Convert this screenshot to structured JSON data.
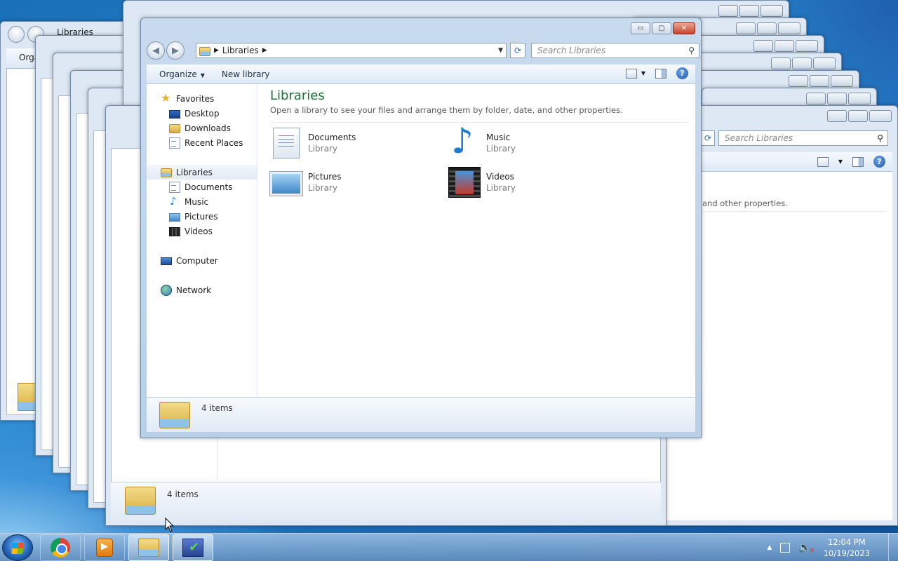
{
  "window": {
    "address": {
      "root_label": "Libraries"
    },
    "search_placeholder": "Search Libraries",
    "controls": {
      "minimize": "▭",
      "maximize": "▢",
      "close": "✕"
    },
    "toolbar": {
      "organize_label": "Organize",
      "new_library_label": "New library",
      "help_label": "?"
    },
    "nav": {
      "favorites": "Favorites",
      "desktop": "Desktop",
      "downloads": "Downloads",
      "recent_places": "Recent Places",
      "libraries": "Libraries",
      "documents": "Documents",
      "music": "Music",
      "pictures": "Pictures",
      "videos": "Videos",
      "computer": "Computer",
      "network": "Network"
    },
    "content": {
      "title": "Libraries",
      "subtitle": "Open a library to see your files and arrange them by folder, date, and other properties.",
      "libraries": [
        {
          "name": "Documents",
          "type": "Library",
          "icon": "documents-library-icon"
        },
        {
          "name": "Music",
          "type": "Library",
          "icon": "music-library-icon"
        },
        {
          "name": "Pictures",
          "type": "Library",
          "icon": "pictures-library-icon"
        },
        {
          "name": "Videos",
          "type": "Library",
          "icon": "videos-library-icon"
        }
      ]
    },
    "details": {
      "item_count": "4 items"
    }
  },
  "ghost_window": {
    "item_count": "4 items",
    "search_placeholder": "Search Libraries",
    "partial_subtitle": "and other properties.",
    "address_label": "Libraries",
    "toolbar_label": "Orga"
  },
  "taskbar": {
    "apps": [
      "start-button",
      "chrome",
      "windows-media-player",
      "windows-explorer",
      "action-center"
    ],
    "clock": {
      "time": "12:04 PM",
      "date": "10/19/2023"
    },
    "tray_arrow": "▲"
  }
}
